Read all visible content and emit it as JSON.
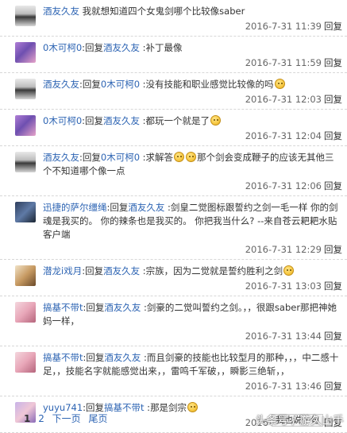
{
  "posts": [
    {
      "avatar": "avatar-a",
      "user": "酒友久友",
      "reply_word": "",
      "target": "",
      "sep": " ",
      "text": "我就想知道四个女鬼剑哪个比较像saber",
      "emojis": [],
      "time": "2016-7-31 11:39",
      "reply": "回复"
    },
    {
      "avatar": "avatar-b",
      "user": "0木可柯0",
      "reply_word": ":回复",
      "target": "酒友久友",
      "sep": " :",
      "text": "补丁最像",
      "emojis": [],
      "time": "2016-7-31 11:59",
      "reply": "回复"
    },
    {
      "avatar": "avatar-a",
      "user": "酒友久友",
      "reply_word": ":回复",
      "target": "0木可柯0",
      "sep": " :",
      "text": "没有技能和职业感觉比较像的吗",
      "emojis": [
        "happy"
      ],
      "time": "2016-7-31 12:03",
      "reply": "回复"
    },
    {
      "avatar": "avatar-b",
      "user": "0木可柯0",
      "reply_word": ":回复",
      "target": "酒友久友",
      "sep": " :",
      "text": "都玩一个就是了",
      "emojis": [
        "happy"
      ],
      "time": "2016-7-31 12:04",
      "reply": "回复"
    },
    {
      "avatar": "avatar-a",
      "user": "酒友久友",
      "reply_word": ":回复",
      "target": "0木可柯0",
      "sep": " :",
      "text": "求解答",
      "emojis": [
        "sad",
        "sad"
      ],
      "text2": "那个剑会变成鞭子的应该无其他三个不知道哪个像一点",
      "time": "2016-7-31 12:06",
      "reply": "回复"
    },
    {
      "avatar": "avatar-c",
      "user": "迅捷的萨尔缰绳",
      "reply_word": ":回复",
      "target": "酒友久友",
      "sep": " :",
      "text": "剑皇二觉图标跟誓约之剑一毛一样 你的剑魂是我买的。 你的辣条也是我买的。 你把我当什么?                    --来自苍云耙耙水贴客户端",
      "emojis": [],
      "time": "2016-7-31 12:29",
      "reply": "回复"
    },
    {
      "avatar": "avatar-d",
      "user": "潜龙i戏月",
      "reply_word": ":回复",
      "target": "酒友久友",
      "sep": " :",
      "text": "宗族，因为二觉就是誓约胜利之剑",
      "emojis": [
        "happy"
      ],
      "time": "2016-7-31 13:03",
      "reply": "回复"
    },
    {
      "avatar": "avatar-e",
      "user": "搞基不带t",
      "reply_word": ":回复",
      "target": "酒友久友",
      "sep": " :",
      "text": "剑豪的二觉叫誓约之剑。，，很跟saber那把神她妈一样，",
      "emojis": [],
      "time": "2016-7-31 13:44",
      "reply": "回复"
    },
    {
      "avatar": "avatar-e",
      "user": "搞基不带t",
      "reply_word": ":回复",
      "target": "酒友久友",
      "sep": " :",
      "text": "而且剑豪的技能也比较型月的那种，，，中二感十足，，技能名字就能感觉出来，，雷鸣千军破，，瞬影三绝斩，，",
      "emojis": [],
      "time": "2016-7-31 13:46",
      "reply": "回复"
    },
    {
      "avatar": "avatar-f",
      "user": "yuyu741",
      "reply_word": ":回复",
      "target": "搞基不带t",
      "sep": " :",
      "text": "那是剑宗",
      "emojis": [
        "happy"
      ],
      "time": "2016-7-31 14:03",
      "reply": "回复"
    }
  ],
  "pager": {
    "current": "1",
    "page2": "2",
    "next": "下一页",
    "last": "尾页"
  },
  "watermark": "头条号 / 游久山手",
  "scroll_btn": "我也说一句"
}
